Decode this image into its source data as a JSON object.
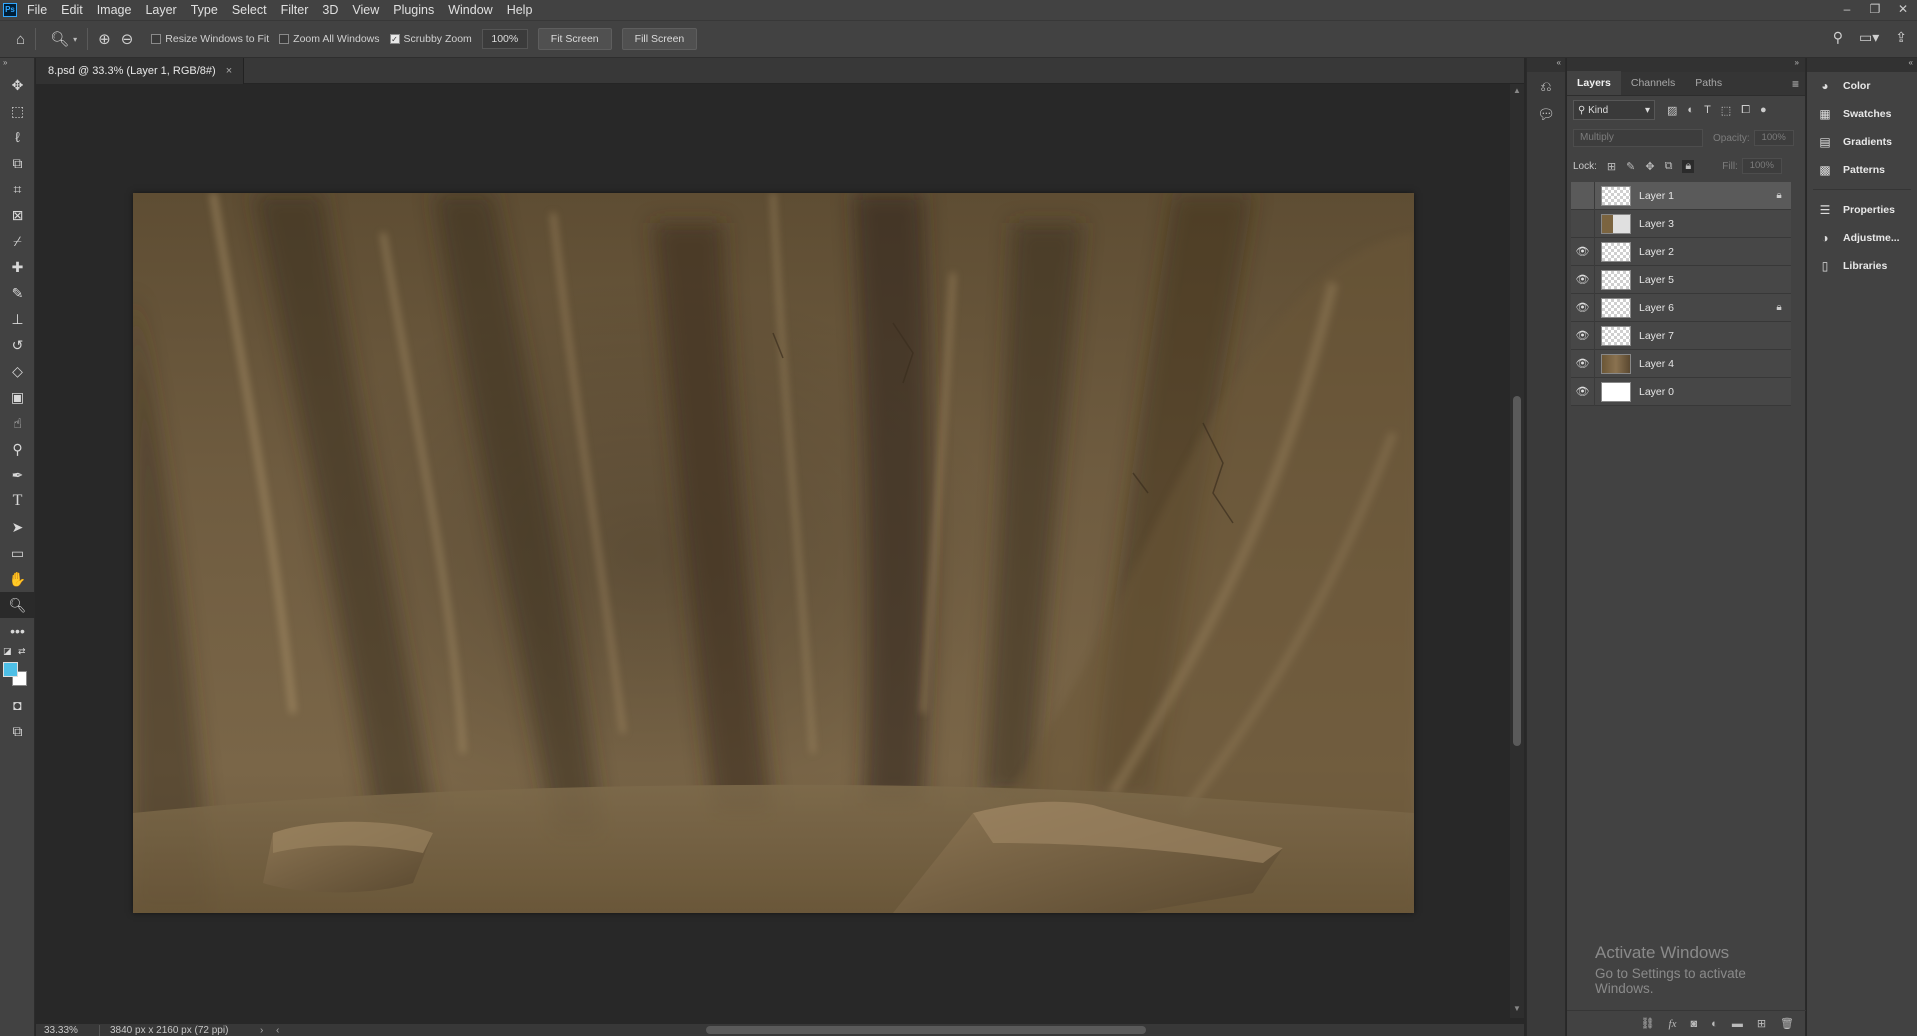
{
  "app": {
    "logo": "Ps",
    "menu": [
      "File",
      "Edit",
      "Image",
      "Layer",
      "Type",
      "Select",
      "Filter",
      "3D",
      "View",
      "Plugins",
      "Window",
      "Help"
    ],
    "window_controls": [
      "–",
      "❐",
      "✕"
    ]
  },
  "options": {
    "resize_windows_label": "Resize Windows to Fit",
    "resize_windows_checked": false,
    "zoom_all_label": "Zoom All Windows",
    "zoom_all_checked": false,
    "scrubby_zoom_label": "Scrubby Zoom",
    "scrubby_zoom_checked": true,
    "zoom_value": "100%",
    "fit_screen_label": "Fit Screen",
    "fill_screen_label": "Fill Screen"
  },
  "document": {
    "tab_title": "8.psd @ 33.3% (Layer 1, RGB/8#)",
    "close_glyph": "×"
  },
  "status": {
    "zoom": "33.33%",
    "dimensions": "3840 px x 2160 px (72 ppi)",
    "arrow": "›",
    "scroll_left": "‹"
  },
  "layers_panel": {
    "tabs": [
      "Layers",
      "Channels",
      "Paths"
    ],
    "active_tab": "Layers",
    "kind_label": "Kind",
    "blend_mode": "Multiply",
    "opacity_label": "Opacity:",
    "opacity_value": "100%",
    "lock_label": "Lock:",
    "fill_label": "Fill:",
    "fill_value": "100%",
    "layers": [
      {
        "name": "Layer 1",
        "visible": false,
        "locked": true,
        "selected": true,
        "thumb": "transparent"
      },
      {
        "name": "Layer 3",
        "visible": false,
        "locked": false,
        "selected": false,
        "thumb": "mixed"
      },
      {
        "name": "Layer 2",
        "visible": true,
        "locked": false,
        "selected": false,
        "thumb": "transparent"
      },
      {
        "name": "Layer 5",
        "visible": true,
        "locked": false,
        "selected": false,
        "thumb": "transparent"
      },
      {
        "name": "Layer 6",
        "visible": true,
        "locked": true,
        "selected": false,
        "thumb": "transparent"
      },
      {
        "name": "Layer 7",
        "visible": true,
        "locked": false,
        "selected": false,
        "thumb": "transparent"
      },
      {
        "name": "Layer 4",
        "visible": true,
        "locked": false,
        "selected": false,
        "thumb": "brown"
      },
      {
        "name": "Layer 0",
        "visible": true,
        "locked": false,
        "selected": false,
        "thumb": "white"
      }
    ]
  },
  "watermark": {
    "line1": "Activate Windows",
    "line2": "Go to Settings to activate Windows."
  },
  "right_panel": {
    "items": [
      {
        "label": "Color",
        "icon": "color-icon"
      },
      {
        "label": "Swatches",
        "icon": "swatches-icon"
      },
      {
        "label": "Gradients",
        "icon": "gradients-icon"
      },
      {
        "label": "Patterns",
        "icon": "patterns-icon"
      },
      {
        "label": "Properties",
        "icon": "properties-icon"
      },
      {
        "label": "Adjustme...",
        "icon": "adjustments-icon"
      },
      {
        "label": "Libraries",
        "icon": "libraries-icon"
      }
    ]
  },
  "colors": {
    "foreground": "#4ebfe6",
    "background": "#ffffff"
  }
}
